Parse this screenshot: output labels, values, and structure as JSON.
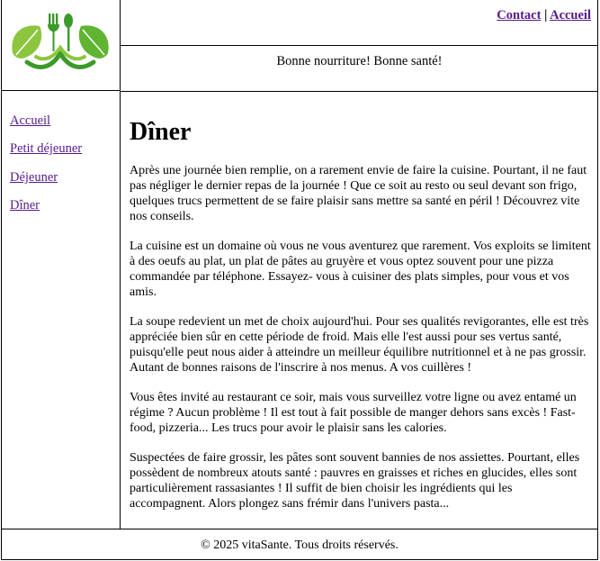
{
  "header": {
    "logo_icon": "fork-spoon-leaves-logo-icon",
    "nav": {
      "contact": "Contact",
      "separator": "|",
      "home": "Accueil"
    },
    "tagline": "Bonne nourriture! Bonne santé!"
  },
  "sidebar": {
    "items": [
      {
        "label": "Accueil"
      },
      {
        "label": "Petit déjeuner"
      },
      {
        "label": "Déjeuner"
      },
      {
        "label": "Dîner"
      }
    ]
  },
  "main": {
    "title": "Dîner",
    "paragraphs": [
      "Après une journée bien remplie, on a rarement envie de faire la cuisine. Pourtant, il ne faut pas négliger le dernier repas de la journée ! Que ce soit au resto ou seul devant son frigo, quelques trucs permettent de se faire plaisir sans mettre sa santé en péril ! Découvrez vite nos conseils.",
      "La cuisine est un domaine où vous ne vous aventurez que rarement. Vos exploits se limitent à des oeufs au plat, un plat de pâtes au gruyère et vous optez souvent pour une pizza commandée par téléphone. Essayez- vous à cuisiner des plats simples, pour vous et vos amis.",
      "La soupe redevient un met de choix aujourd'hui. Pour ses qualités revigorantes, elle est très appréciée bien sûr en cette période de froid. Mais elle l'est aussi pour ses vertus santé, puisqu'elle peut nous aider à atteindre un meilleur équilibre nutritionnel et à ne pas grossir. Autant de bonnes raisons de l'inscrire à nos menus. A vos cuillères !",
      "Vous êtes invité au restaurant ce soir, mais vous surveillez votre ligne ou avez entamé un régime ? Aucun problème ! Il est tout à fait possible de manger dehors sans excès ! Fast-food, pizzeria... Les trucs pour avoir le plaisir sans les calories.",
      "Suspectées de faire grossir, les pâtes sont souvent bannies de nos assiettes. Pourtant, elles possèdent de nombreux atouts santé : pauvres en graisses et riches en glucides, elles sont particulièrement rassasiantes ! Il suffit de bien choisir les ingrédients qui les accompagnent. Alors plongez sans frémir dans l'univers pasta..."
    ]
  },
  "footer": {
    "text": "© 2025 vitaSante. Tous droits réservés."
  },
  "colors": {
    "link": "#551a8b",
    "logo_green_light": "#8cc63f",
    "logo_green_dark": "#3a9a2a"
  }
}
